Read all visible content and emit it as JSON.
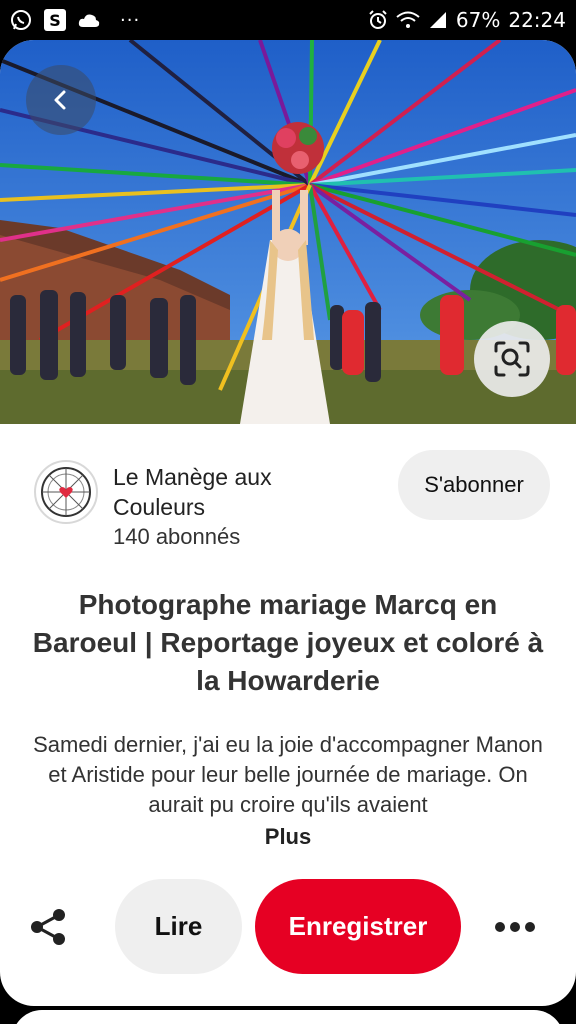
{
  "status_bar": {
    "battery": "67%",
    "time": "22:24",
    "app_s_label": "S",
    "overflow": "···"
  },
  "pin": {
    "image_alt_icons": [
      "back-arrow-icon",
      "visual-search-icon"
    ],
    "creator": {
      "name": "Le Manège aux Couleurs",
      "followers": "140 abonnés"
    },
    "subscribe_label": "S'abonner",
    "title": "Photographe mariage Marcq en Baroeul | Reportage joyeux et coloré à la Howarderie",
    "description": "Samedi dernier, j'ai eu la joie d'accompagner Manon et Aristide pour leur belle journée de mariage. On aurait pu croire qu'ils avaient",
    "more_label": "Plus"
  },
  "actions": {
    "read_label": "Lire",
    "save_label": "Enregistrer"
  },
  "colors": {
    "save_red": "#e60023",
    "button_grey": "#efefef",
    "sky": "#2f6fcf"
  }
}
